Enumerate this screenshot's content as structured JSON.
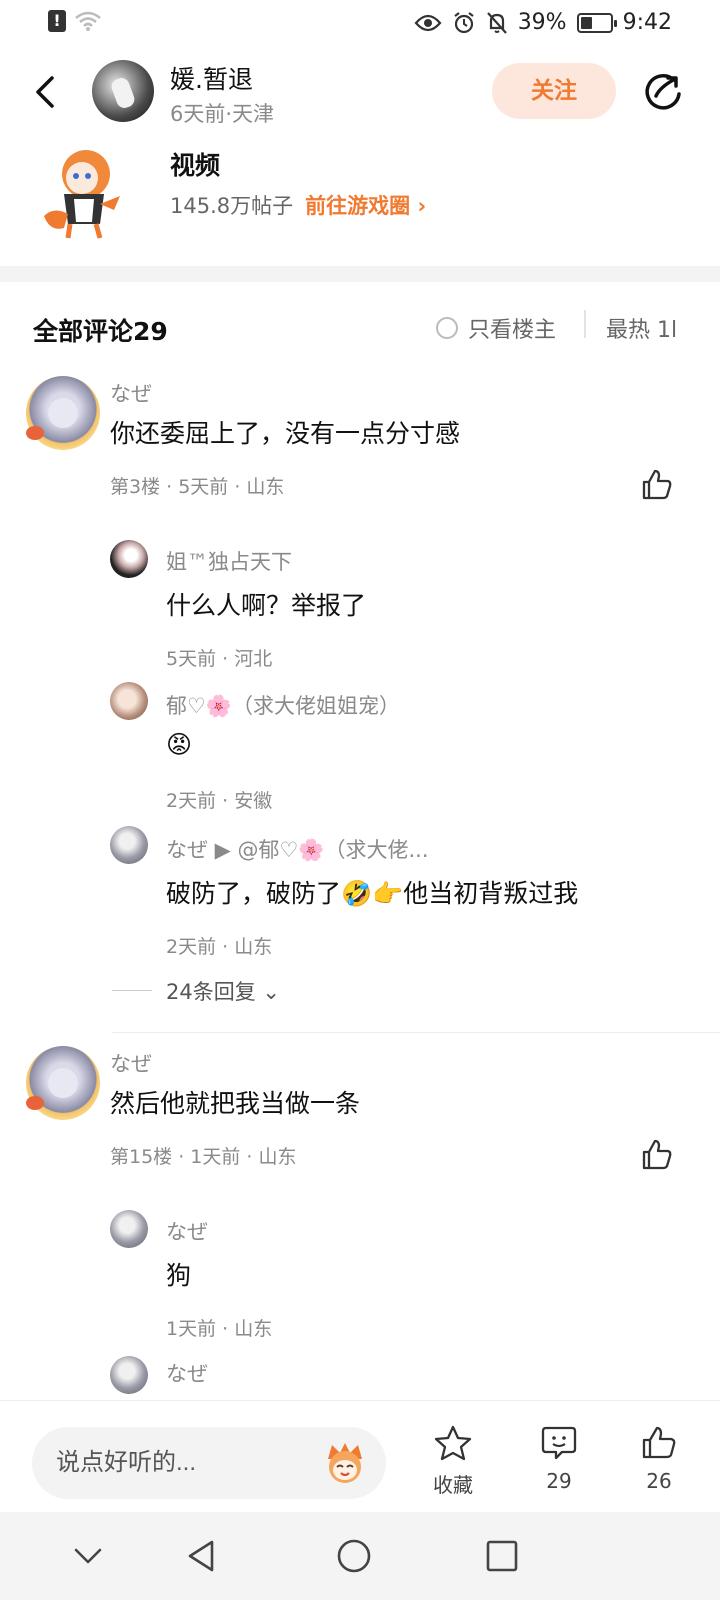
{
  "status_bar": {
    "battery": "39%",
    "time": "9:42",
    "battery_level": 0.39,
    "icons": [
      "alert-icon",
      "wifi-icon",
      "eye-icon",
      "alarm-icon",
      "mute-icon",
      "battery-icon"
    ]
  },
  "header": {
    "author_name": "媛.暂退",
    "author_meta": "6天前·天津",
    "follow_label": "关注"
  },
  "circle": {
    "name": "视频",
    "posts": "145.8万帖子",
    "link_label": "前往游戏圈",
    "link_arrow": "›"
  },
  "comments_header": {
    "title": "全部评论29",
    "only_op": "只看楼主",
    "sort": "最热 1l"
  },
  "comments": [
    {
      "name": "なぜ",
      "text": "你还委屈上了，没有一点分寸感",
      "meta": "第3楼 · 5天前 · 山东",
      "replies": [
        {
          "name": "姐™独占天下",
          "text": "什么人啊？举报了",
          "meta": "5天前 · 河北"
        },
        {
          "name": "郁♡🌸（求大佬姐姐宠）",
          "text": "😡",
          "meta": "2天前 · 安徽"
        },
        {
          "name": "なぜ ▶ @郁♡🌸（求大佬...",
          "text": "破防了，破防了🤣👉他当初背叛过我",
          "meta": "2天前 · 山东"
        }
      ],
      "more_replies": "24条回复 ⌄"
    },
    {
      "name": "なぜ",
      "text": "然后他就把我当做一条",
      "meta": "第15楼 · 1天前 · 山东",
      "replies": [
        {
          "name": "なぜ",
          "text": "狗",
          "meta": "1天前 · 山东"
        },
        {
          "name": "なぜ"
        }
      ]
    }
  ],
  "bottom_bar": {
    "input_placeholder": "说点好听的...",
    "favorite_label": "收藏",
    "comment_count": "29",
    "like_count": "26"
  },
  "colors": {
    "accent": "#f07a2f",
    "follow_bg": "#fde6dc",
    "secondary_text": "#8a8a8a"
  }
}
